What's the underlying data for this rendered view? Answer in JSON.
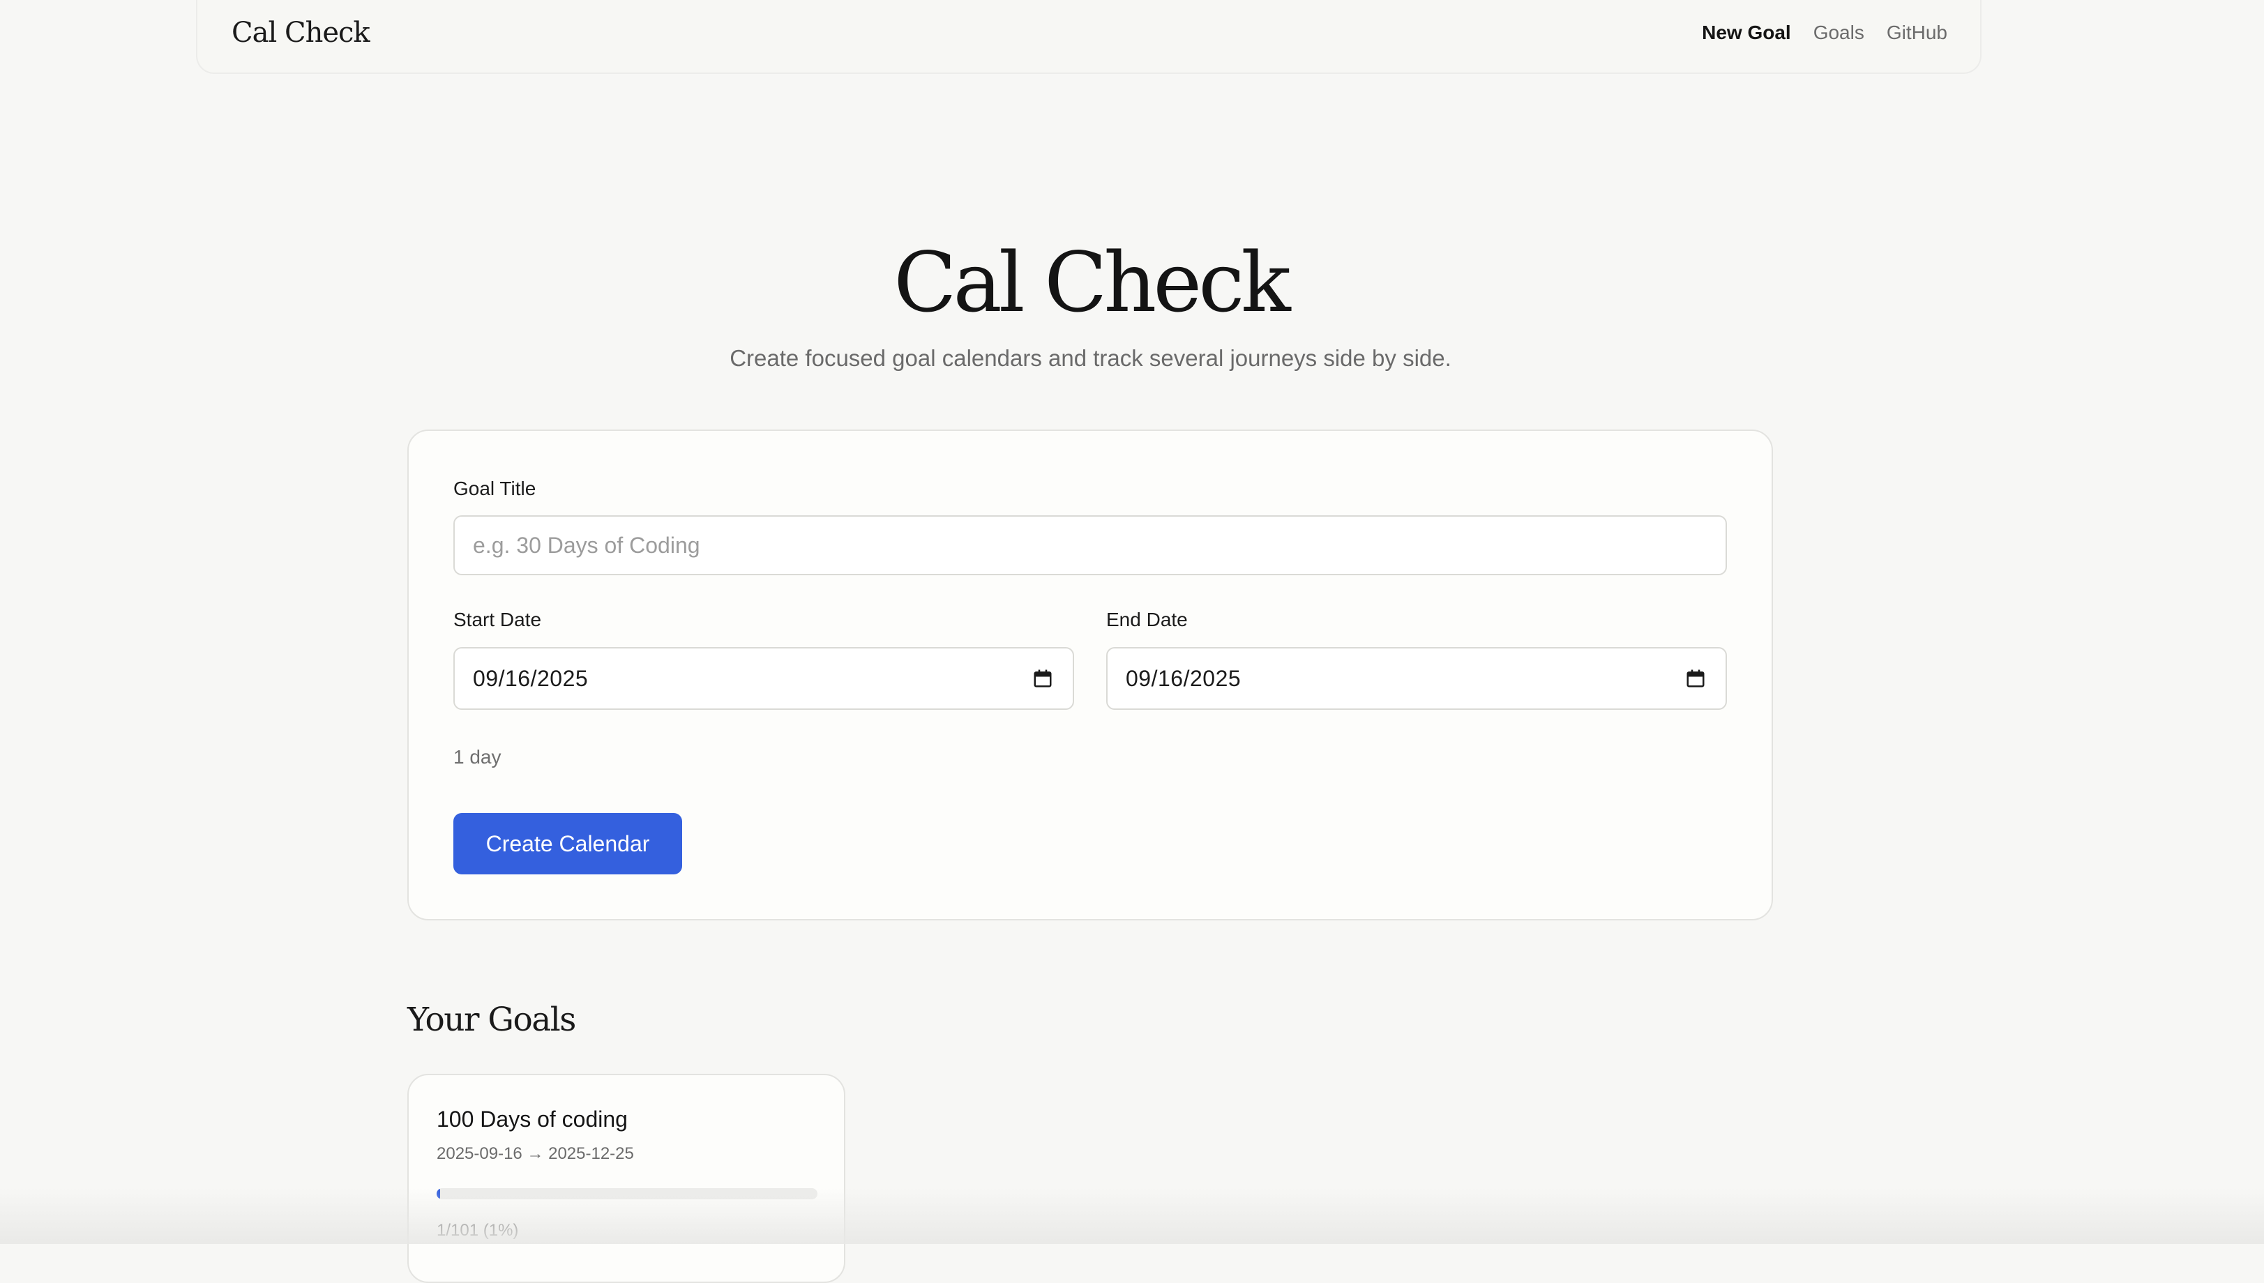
{
  "header": {
    "brand": "Cal Check",
    "nav": [
      {
        "label": "New Goal",
        "active": true
      },
      {
        "label": "Goals",
        "active": false
      },
      {
        "label": "GitHub",
        "active": false
      }
    ]
  },
  "hero": {
    "title": "Cal Check",
    "subtitle": "Create focused goal calendars and track several journeys side by side."
  },
  "form": {
    "goal_title_label": "Goal Title",
    "goal_title_placeholder": "e.g. 30 Days of Coding",
    "goal_title_value": "",
    "start_date_label": "Start Date",
    "start_date_value": "09/16/2025",
    "end_date_label": "End Date",
    "end_date_value": "09/16/2025",
    "duration_text": "1 day",
    "submit_label": "Create Calendar",
    "icon": "calendar-icon"
  },
  "goals_section": {
    "title": "Your Goals",
    "items": [
      {
        "title": "100 Days of coding",
        "date_range": "2025-09-16 → 2025-12-25",
        "progress_fraction": 0.01,
        "progress_text": "1/101 (1%)"
      }
    ]
  },
  "colors": {
    "accent": "#3460de",
    "background": "#f7f7f5",
    "card_background": "#fdfdfb",
    "muted_text": "#6b6b6b"
  }
}
